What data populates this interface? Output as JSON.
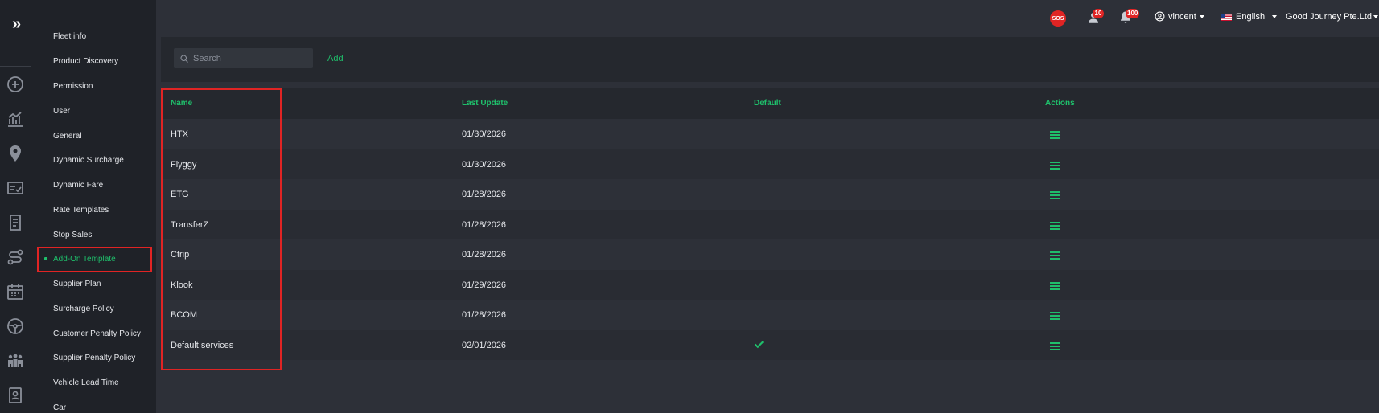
{
  "rail": {
    "expand_icon": "double-chevron-right-icon",
    "icons": [
      "plus-circle-icon",
      "chart-icon",
      "map-pin-icon",
      "checklist-icon",
      "document-icon",
      "route-icon",
      "calendar-icon",
      "steering-wheel-icon",
      "team-icon",
      "contact-icon"
    ]
  },
  "submenu": {
    "items": [
      "Fleet info",
      "Product Discovery",
      "Permission",
      "User",
      "General",
      "Dynamic Surcharge",
      "Dynamic Fare",
      "Rate Templates",
      "Stop Sales",
      "Add-On Template",
      "Supplier Plan",
      "Surcharge Policy",
      "Customer Penalty Policy",
      "Supplier Penalty Policy",
      "Vehicle Lead Time",
      "Car"
    ],
    "active_index": 9
  },
  "header": {
    "sos_label": "SOS",
    "driver_badge": "10",
    "notification_badge": "100",
    "user_name": "vincent",
    "language": "English",
    "company": "Good Journey Pte.Ltd"
  },
  "toolbar": {
    "search_placeholder": "Search",
    "add_label": "Add"
  },
  "table": {
    "columns": [
      "Name",
      "Last Update",
      "Default",
      "Actions"
    ],
    "rows": [
      {
        "name": "HTX",
        "last_update": "01/30/2026",
        "default": false
      },
      {
        "name": "Flyggy",
        "last_update": "01/30/2026",
        "default": false
      },
      {
        "name": "ETG",
        "last_update": "01/28/2026",
        "default": false
      },
      {
        "name": "TransferZ",
        "last_update": "01/28/2026",
        "default": false
      },
      {
        "name": "Ctrip",
        "last_update": "01/28/2026",
        "default": false
      },
      {
        "name": "Klook",
        "last_update": "01/29/2026",
        "default": false
      },
      {
        "name": "BCOM",
        "last_update": "01/28/2026",
        "default": false
      },
      {
        "name": "Default services",
        "last_update": "02/01/2026",
        "default": true
      }
    ]
  },
  "colors": {
    "accent": "#1fbf6b",
    "highlight": "#e02424",
    "sidebar_bg": "#1f2228",
    "content_bg": "#2d3038"
  }
}
